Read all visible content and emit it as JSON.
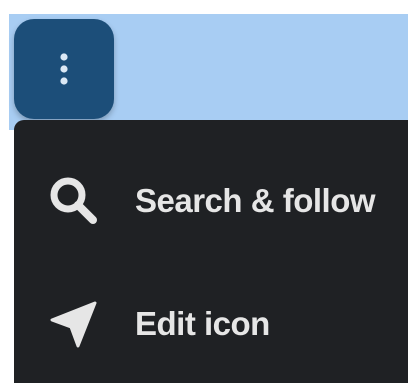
{
  "toolbar": {
    "more_button_icon": "more-vert-icon"
  },
  "menu": {
    "items": [
      {
        "label": "Search & follow",
        "icon": "search-icon"
      },
      {
        "label": "Edit icon",
        "icon": "navigation-arrow-icon"
      }
    ]
  },
  "colors": {
    "top_band": "#a8cdf3",
    "button_bg": "#1c4e79",
    "menu_bg": "#1f2124",
    "menu_text": "#e6e6e6",
    "icon": "#e6e6e6"
  }
}
